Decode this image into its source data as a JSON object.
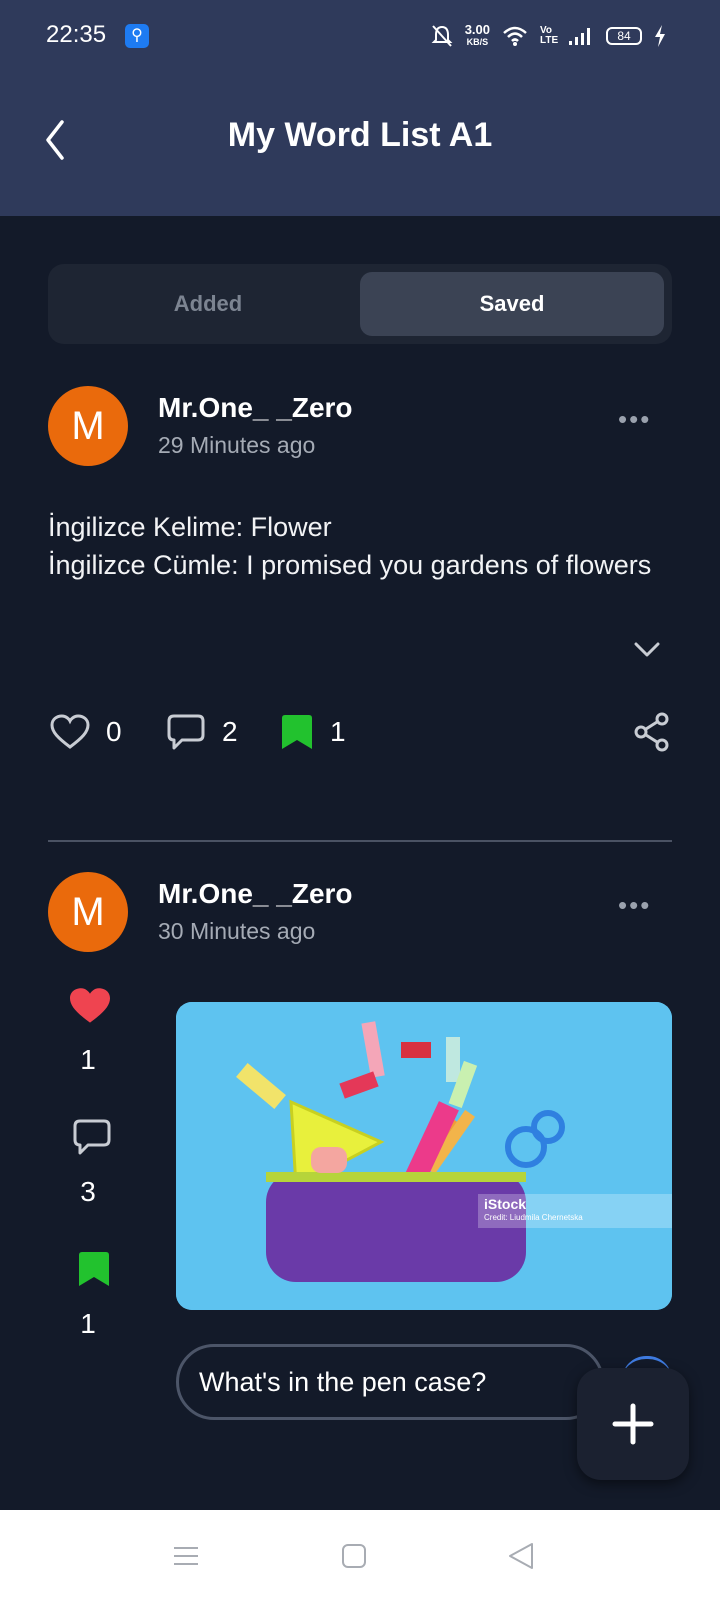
{
  "status": {
    "time": "22:35",
    "net_speed": "3.00",
    "net_unit": "KB/S",
    "volte": "Vo LTE",
    "battery": "84"
  },
  "header": {
    "title": "My Word List A1"
  },
  "tabs": {
    "added": "Added",
    "saved": "Saved",
    "active": "saved"
  },
  "posts": [
    {
      "avatar_letter": "M",
      "username": "Mr.One_ _Zero",
      "time_ago": "29 Minutes ago",
      "lines": [
        "İngilizce Kelime: Flower",
        "İngilizce Cümle: I promised you gardens of flowers"
      ],
      "likes": "0",
      "comments": "2",
      "saves": "1"
    },
    {
      "avatar_letter": "M",
      "username": "Mr.One_ _Zero",
      "time_ago": "30 Minutes ago",
      "likes": "1",
      "comments": "3",
      "saves": "1",
      "image": {
        "watermark": "iStock",
        "credit": "Credit: Liudmila Chernetska"
      },
      "caption": "What's in the pen case?"
    }
  ],
  "colors": {
    "header_bg": "#2f3a5b",
    "page_bg": "#131a29",
    "avatar": "#ea6a0c",
    "save_green": "#22c22e",
    "like_red": "#ef4450"
  },
  "icons": [
    "back-icon",
    "more-icon",
    "chevron-down-icon",
    "heart-icon",
    "comment-icon",
    "bookmark-icon",
    "share-icon",
    "plus-icon",
    "menu-icon",
    "home-icon",
    "nav-back-icon"
  ]
}
